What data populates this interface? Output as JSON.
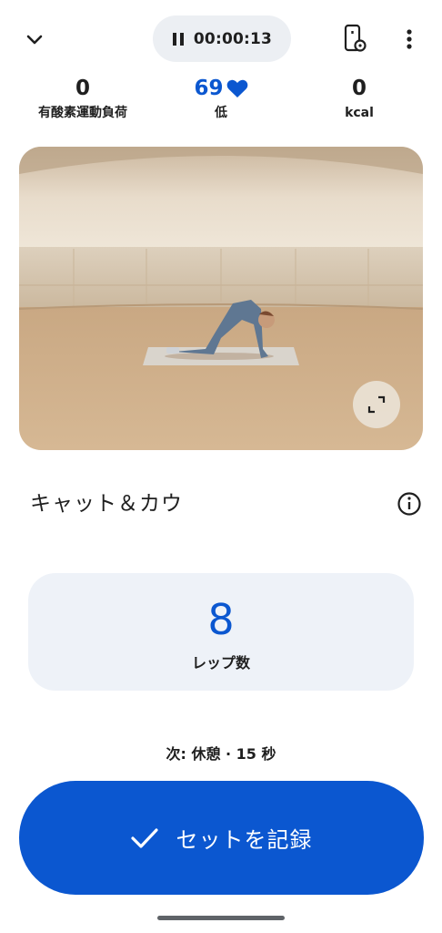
{
  "header": {
    "collapse_icon": "chevron-down-icon",
    "timer": {
      "icon": "pause-icon",
      "elapsed": "00:00:13"
    },
    "watch_icon": "watch-settings-icon",
    "more_icon": "more-vert-icon"
  },
  "stats": {
    "cardio_load": {
      "value": "0",
      "label": "有酸素運動負荷"
    },
    "heart_rate": {
      "value": "69",
      "icon": "heart-icon",
      "label": "低"
    },
    "calories": {
      "value": "0",
      "label": "kcal"
    }
  },
  "video": {
    "expand_icon": "fullscreen-icon"
  },
  "exercise": {
    "title": "キャット＆カウ",
    "info_icon": "info-icon"
  },
  "reps": {
    "count": "8",
    "label": "レップ数"
  },
  "next": {
    "text": "次: 休憩 · 15 秒"
  },
  "log_button": {
    "icon": "check-icon",
    "label": "セットを記録"
  },
  "colors": {
    "accent": "#0b57d0",
    "card_bg": "#eef2f8",
    "pill_bg": "#eceff3"
  }
}
